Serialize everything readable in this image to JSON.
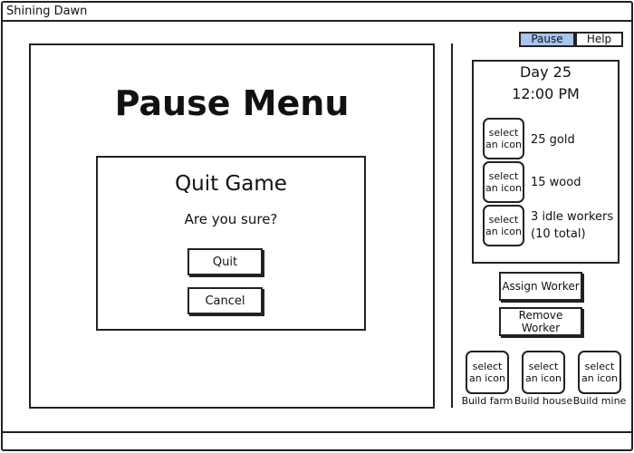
{
  "window": {
    "title": "Shining Dawn"
  },
  "pause_menu": {
    "title": "Pause Menu",
    "dialog": {
      "title": "Quit Game",
      "message": "Are you sure?",
      "quit_label": "Quit",
      "cancel_label": "Cancel"
    }
  },
  "tabs": [
    {
      "label": "Pause",
      "selected": true
    },
    {
      "label": "Help",
      "selected": false
    }
  ],
  "status": {
    "day": "Day 25",
    "time": "12:00 PM",
    "resources": [
      {
        "icon_text": "select an icon",
        "line1": "25 gold",
        "line2": ""
      },
      {
        "icon_text": "select an icon",
        "line1": "15 wood",
        "line2": ""
      },
      {
        "icon_text": "select an icon",
        "line1": "3 idle workers",
        "line2": "(10 total)"
      }
    ]
  },
  "actions": {
    "assign_label": "Assign Worker",
    "remove_label": "Remove Worker"
  },
  "build": [
    {
      "icon_text": "select an icon",
      "label": "Build farm"
    },
    {
      "icon_text": "select an icon",
      "label": "Build house"
    },
    {
      "icon_text": "select an icon",
      "label": "Build mine"
    }
  ],
  "colors": {
    "selected_tab": "#a7c5ee",
    "ink": "#222222"
  }
}
